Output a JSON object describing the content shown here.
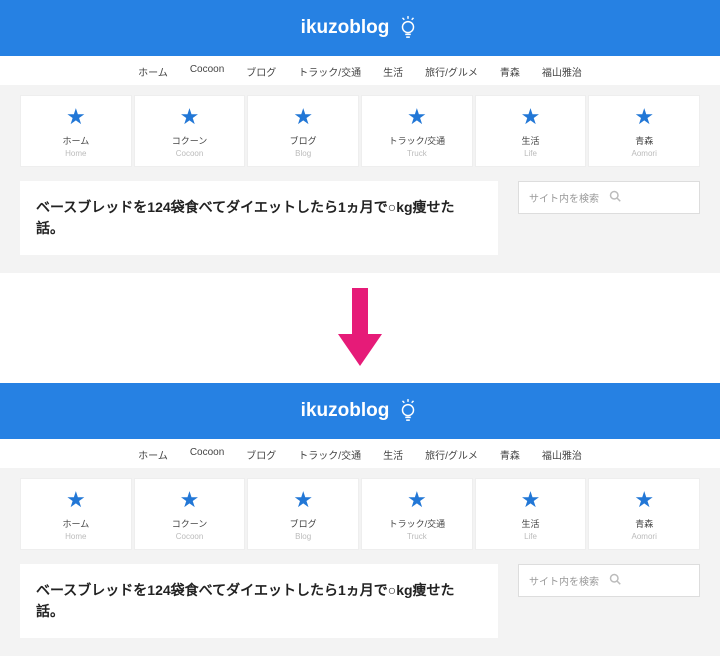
{
  "hero": {
    "title": "ikuzoblog"
  },
  "nav": [
    "ホーム",
    "Cocoon",
    "ブログ",
    "トラック/交通",
    "生活",
    "旅行/グルメ",
    "青森",
    "福山雅治"
  ],
  "cards": [
    {
      "jp": "ホーム",
      "en": "Home"
    },
    {
      "jp": "コクーン",
      "en": "Cocoon"
    },
    {
      "jp": "ブログ",
      "en": "Blog"
    },
    {
      "jp": "トラック/交通",
      "en": "Truck"
    },
    {
      "jp": "生活",
      "en": "Life"
    },
    {
      "jp": "青森",
      "en": "Aomori"
    }
  ],
  "article": {
    "title": "ベースブレッドを124袋食べてダイエットしたら1ヵ月で○kg痩せた話。"
  },
  "search": {
    "placeholder": "サイト内を検索"
  }
}
